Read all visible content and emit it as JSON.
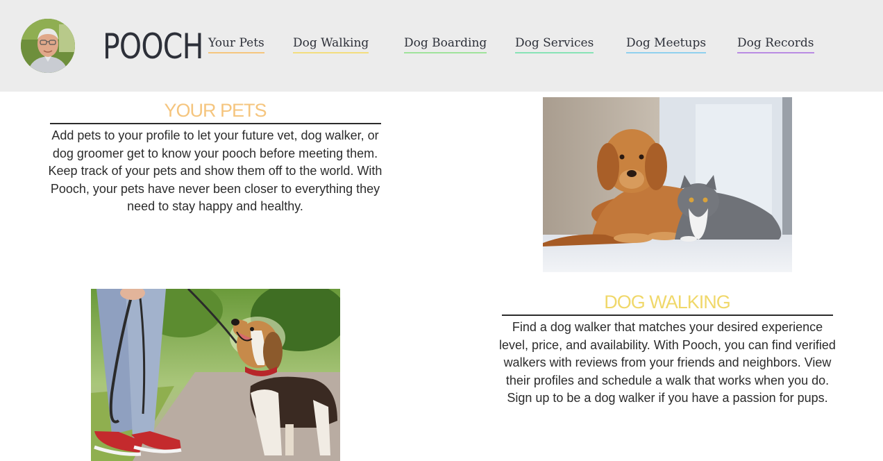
{
  "header": {
    "logo_text": "POOCH",
    "nav": [
      {
        "label": "Your Pets",
        "underline_color": "#f5c57e"
      },
      {
        "label": "Dog Walking",
        "underline_color": "#f3dd7e"
      },
      {
        "label": "Dog Boarding",
        "underline_color": "#9fe39b"
      },
      {
        "label": "Dog Services",
        "underline_color": "#87e3b6"
      },
      {
        "label": "Dog Meetups",
        "underline_color": "#8fd0ee"
      },
      {
        "label": "Dog Records",
        "underline_color": "#b98be3"
      }
    ]
  },
  "sections": {
    "your_pets": {
      "title": "YOUR PETS",
      "title_color": "#f5c57e",
      "description": "Add pets to your profile to let your future vet, dog walker, or dog groomer get to know your pooch before meeting them. Keep track of your pets and show them off to the world. With Pooch, your pets have never been closer to everything they need to stay happy and healthy."
    },
    "dog_walking": {
      "title": "DOG WALKING",
      "title_color": "#f0d86a",
      "description": "Find a dog walker that matches your desired experience level, price, and availability. With Pooch, you can find verified walkers with reviews from your friends and neighbors. View their profiles and schedule a walk that works when you do. Sign up to be a dog walker if you have a passion for pups."
    }
  }
}
